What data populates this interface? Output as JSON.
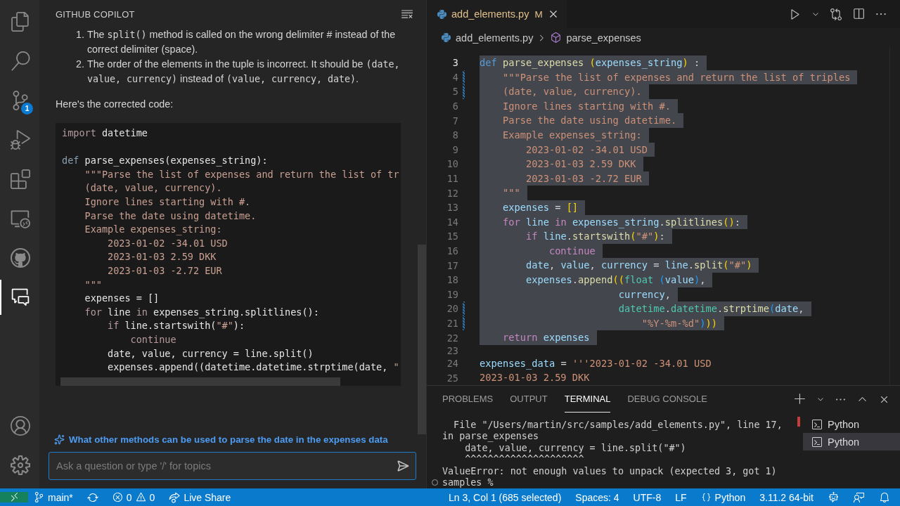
{
  "activity_bar": {
    "items": [
      {
        "kind": "files",
        "selected": false
      },
      {
        "kind": "search",
        "selected": false
      },
      {
        "kind": "source_control",
        "selected": false,
        "badge": "1"
      },
      {
        "kind": "debug",
        "selected": false
      },
      {
        "kind": "extensions",
        "selected": false
      },
      {
        "kind": "remote",
        "selected": false
      },
      {
        "kind": "github",
        "selected": false
      },
      {
        "kind": "chat",
        "selected": true
      }
    ],
    "bottom": [
      {
        "kind": "account"
      },
      {
        "kind": "settings"
      }
    ]
  },
  "sidebar": {
    "title": "GITHUB COPILOT",
    "answer_list": [
      {
        "marker": "1.",
        "segments": [
          {
            "kind": "text",
            "text": "The "
          },
          {
            "kind": "code",
            "text": "split()"
          },
          {
            "kind": "text",
            "text": " method is called on the wrong delimiter # instead of the correct delimiter (space)."
          }
        ]
      },
      {
        "marker": "2.",
        "segments": [
          {
            "kind": "text",
            "text": "The order of the elements in the tuple is incorrect. It should be "
          },
          {
            "kind": "code",
            "text": "(date, value, currency)"
          },
          {
            "kind": "text",
            "text": " instead of "
          },
          {
            "kind": "code",
            "text": "(value, currency, date)"
          },
          {
            "kind": "text",
            "text": "."
          }
        ]
      }
    ],
    "paragraph": "Here's the corrected code:",
    "code_lines": [
      {
        "kind": "code",
        "tokens": [
          {
            "kind": "ctl",
            "text": "import "
          },
          {
            "kind": "pl",
            "text": "datetime"
          }
        ]
      },
      {
        "kind": "blank"
      },
      {
        "kind": "code",
        "tokens": [
          {
            "kind": "kw",
            "text": "def "
          },
          {
            "kind": "fn",
            "text": "parse_expenses"
          },
          {
            "kind": "pl",
            "text": "(expenses_string):"
          }
        ]
      },
      {
        "kind": "code",
        "tokens": [
          {
            "kind": "str",
            "text": "    \"\"\"Parse the list of expenses and return the list of tr"
          }
        ]
      },
      {
        "kind": "code",
        "tokens": [
          {
            "kind": "str",
            "text": "    (date, value, currency)."
          }
        ]
      },
      {
        "kind": "code",
        "tokens": [
          {
            "kind": "str",
            "text": "    Ignore lines starting with #."
          }
        ]
      },
      {
        "kind": "code",
        "tokens": [
          {
            "kind": "str",
            "text": "    Parse the date using datetime."
          }
        ]
      },
      {
        "kind": "code",
        "tokens": [
          {
            "kind": "str",
            "text": "    Example expenses_string:"
          }
        ]
      },
      {
        "kind": "code",
        "tokens": [
          {
            "kind": "str",
            "text": "        2023-01-02 -34.01 USD"
          }
        ]
      },
      {
        "kind": "code",
        "tokens": [
          {
            "kind": "str",
            "text": "        2023-01-03 2.59 DKK"
          }
        ]
      },
      {
        "kind": "code",
        "tokens": [
          {
            "kind": "str",
            "text": "        2023-01-03 -2.72 EUR"
          }
        ]
      },
      {
        "kind": "code",
        "tokens": [
          {
            "kind": "str",
            "text": "    \"\"\""
          }
        ]
      },
      {
        "kind": "code",
        "tokens": [
          {
            "kind": "pl",
            "text": "    expenses = []"
          }
        ]
      },
      {
        "kind": "code",
        "tokens": [
          {
            "kind": "ctl",
            "text": "    for "
          },
          {
            "kind": "pl",
            "text": "line "
          },
          {
            "kind": "ctl",
            "text": "in "
          },
          {
            "kind": "pl",
            "text": "expenses_string.splitlines():"
          }
        ]
      },
      {
        "kind": "code",
        "tokens": [
          {
            "kind": "ctl",
            "text": "        if "
          },
          {
            "kind": "pl",
            "text": "line.startswith("
          },
          {
            "kind": "str",
            "text": "\"#\""
          },
          {
            "kind": "pl",
            "text": "):"
          }
        ]
      },
      {
        "kind": "code",
        "tokens": [
          {
            "kind": "ctl",
            "text": "            continue"
          }
        ]
      },
      {
        "kind": "code",
        "tokens": [
          {
            "kind": "pl",
            "text": "        date, value, currency = line.split()"
          }
        ]
      },
      {
        "kind": "code",
        "tokens": [
          {
            "kind": "pl",
            "text": "        expenses.append((datetime.datetime.strptime(date, "
          },
          {
            "kind": "str",
            "text": "\""
          }
        ]
      }
    ],
    "suggestion": "What other methods can be used to parse the date in the expenses data",
    "input": {
      "placeholder": "Ask a question or type '/' for topics"
    }
  },
  "editor": {
    "tab": {
      "filename": "add_elements.py",
      "status": "M",
      "selected": true
    },
    "breadcrumb": [
      {
        "kind": "file",
        "label": "add_elements.py"
      },
      {
        "kind": "symbol",
        "label": "parse_expenses"
      }
    ],
    "lines": [
      {
        "number": "3",
        "selected": true,
        "active": true,
        "modified": false,
        "tokens": [
          {
            "kind": "kw",
            "text": "def "
          },
          {
            "kind": "fn",
            "text": "parse_expenses "
          },
          {
            "kind": "br",
            "text": "("
          },
          {
            "kind": "var",
            "text": "expenses_string"
          },
          {
            "kind": "br",
            "text": ")"
          },
          {
            "kind": "pl",
            "text": " :"
          }
        ]
      },
      {
        "number": "4",
        "selected": true,
        "active": false,
        "modified": true,
        "tokens": [
          {
            "kind": "str",
            "text": "    \"\"\"Parse the list of expenses and return the list of triples"
          }
        ]
      },
      {
        "number": "5",
        "selected": true,
        "active": false,
        "modified": true,
        "tokens": [
          {
            "kind": "str",
            "text": "    (date, value, currency)."
          }
        ]
      },
      {
        "number": "6",
        "selected": true,
        "active": false,
        "modified": false,
        "tokens": [
          {
            "kind": "str",
            "text": "    Ignore lines starting with #."
          }
        ]
      },
      {
        "number": "7",
        "selected": true,
        "active": false,
        "modified": false,
        "tokens": [
          {
            "kind": "str",
            "text": "    Parse the date using datetime."
          }
        ]
      },
      {
        "number": "8",
        "selected": true,
        "active": false,
        "modified": false,
        "tokens": [
          {
            "kind": "str",
            "text": "    Example expenses_string:"
          }
        ]
      },
      {
        "number": "9",
        "selected": true,
        "active": false,
        "modified": false,
        "tokens": [
          {
            "kind": "str",
            "text": "        2023-01-02 -34.01 USD"
          }
        ]
      },
      {
        "number": "10",
        "selected": true,
        "active": false,
        "modified": false,
        "tokens": [
          {
            "kind": "str",
            "text": "        2023-01-03 2.59 DKK"
          }
        ]
      },
      {
        "number": "11",
        "selected": true,
        "active": false,
        "modified": false,
        "tokens": [
          {
            "kind": "str",
            "text": "        2023-01-03 -2.72 EUR"
          }
        ]
      },
      {
        "number": "12",
        "selected": true,
        "active": false,
        "modified": false,
        "tokens": [
          {
            "kind": "str",
            "text": "    \"\"\""
          }
        ]
      },
      {
        "number": "13",
        "selected": true,
        "active": false,
        "modified": false,
        "tokens": [
          {
            "kind": "var",
            "text": "    expenses"
          },
          {
            "kind": "pl",
            "text": " = "
          },
          {
            "kind": "br",
            "text": "[]"
          }
        ]
      },
      {
        "number": "14",
        "selected": true,
        "active": false,
        "modified": false,
        "tokens": [
          {
            "kind": "ctl",
            "text": "    for "
          },
          {
            "kind": "var",
            "text": "line "
          },
          {
            "kind": "ctl",
            "text": "in "
          },
          {
            "kind": "var",
            "text": "expenses_string"
          },
          {
            "kind": "pl",
            "text": "."
          },
          {
            "kind": "fn",
            "text": "splitlines"
          },
          {
            "kind": "br",
            "text": "()"
          },
          {
            "kind": "pl",
            "text": ":"
          }
        ]
      },
      {
        "number": "15",
        "selected": true,
        "active": false,
        "modified": false,
        "tokens": [
          {
            "kind": "ctl",
            "text": "        if "
          },
          {
            "kind": "var",
            "text": "line"
          },
          {
            "kind": "pl",
            "text": "."
          },
          {
            "kind": "fn",
            "text": "startswith"
          },
          {
            "kind": "br",
            "text": "("
          },
          {
            "kind": "str",
            "text": "\"#\""
          },
          {
            "kind": "br",
            "text": ")"
          },
          {
            "kind": "pl",
            "text": ":"
          }
        ]
      },
      {
        "number": "16",
        "selected": true,
        "active": false,
        "modified": false,
        "tokens": [
          {
            "kind": "ctl",
            "text": "            continue"
          }
        ]
      },
      {
        "number": "17",
        "selected": true,
        "active": false,
        "modified": false,
        "tokens": [
          {
            "kind": "var",
            "text": "        date"
          },
          {
            "kind": "pl",
            "text": ", "
          },
          {
            "kind": "var",
            "text": "value"
          },
          {
            "kind": "pl",
            "text": ", "
          },
          {
            "kind": "var",
            "text": "currency"
          },
          {
            "kind": "pl",
            "text": " = "
          },
          {
            "kind": "var",
            "text": "line"
          },
          {
            "kind": "pl",
            "text": "."
          },
          {
            "kind": "fn",
            "text": "split"
          },
          {
            "kind": "br",
            "text": "("
          },
          {
            "kind": "str",
            "text": "\"#\""
          },
          {
            "kind": "br",
            "text": ")"
          }
        ]
      },
      {
        "number": "18",
        "selected": true,
        "active": false,
        "modified": false,
        "tokens": [
          {
            "kind": "var",
            "text": "        expenses"
          },
          {
            "kind": "pl",
            "text": "."
          },
          {
            "kind": "fn",
            "text": "append"
          },
          {
            "kind": "br",
            "text": "(("
          },
          {
            "kind": "cls",
            "text": "float "
          },
          {
            "kind": "br2",
            "text": "("
          },
          {
            "kind": "var",
            "text": "value"
          },
          {
            "kind": "br2",
            "text": ")"
          },
          {
            "kind": "pl",
            "text": ","
          }
        ]
      },
      {
        "number": "19",
        "selected": true,
        "active": false,
        "modified": false,
        "tokens": [
          {
            "kind": "var",
            "text": "                        currency"
          },
          {
            "kind": "pl",
            "text": ","
          }
        ]
      },
      {
        "number": "20",
        "selected": true,
        "active": false,
        "modified": true,
        "tokens": [
          {
            "kind": "cls",
            "text": "                        datetime"
          },
          {
            "kind": "pl",
            "text": "."
          },
          {
            "kind": "cls",
            "text": "datetime"
          },
          {
            "kind": "pl",
            "text": "."
          },
          {
            "kind": "fn",
            "text": "strptime"
          },
          {
            "kind": "br2",
            "text": "("
          },
          {
            "kind": "var",
            "text": "date"
          },
          {
            "kind": "pl",
            "text": ","
          }
        ]
      },
      {
        "number": "21",
        "selected": true,
        "active": false,
        "modified": true,
        "tokens": [
          {
            "kind": "str",
            "text": "                            \"%Y-%m-%d\""
          },
          {
            "kind": "br2",
            "text": ")"
          },
          {
            "kind": "br",
            "text": "))"
          }
        ]
      },
      {
        "number": "22",
        "selected": true,
        "active": false,
        "modified": false,
        "tokens": [
          {
            "kind": "ctl",
            "text": "    return "
          },
          {
            "kind": "var",
            "text": "expenses"
          }
        ]
      },
      {
        "number": "23",
        "selected": false,
        "active": false,
        "modified": false
      },
      {
        "number": "24",
        "selected": false,
        "active": false,
        "modified": false,
        "tokens": [
          {
            "kind": "var",
            "text": "expenses_data"
          },
          {
            "kind": "pl",
            "text": " = "
          },
          {
            "kind": "str",
            "text": "'''2023-01-02 -34.01 USD"
          }
        ]
      },
      {
        "number": "25",
        "selected": false,
        "active": false,
        "modified": false,
        "tokens": [
          {
            "kind": "str",
            "text": "2023-01-03 2.59 DKK"
          }
        ]
      }
    ]
  },
  "panel": {
    "tabs": [
      {
        "label": "PROBLEMS",
        "selected": false
      },
      {
        "label": "OUTPUT",
        "selected": false
      },
      {
        "label": "TERMINAL",
        "selected": true
      },
      {
        "label": "DEBUG CONSOLE",
        "selected": false
      }
    ],
    "terminal_lines": [
      {
        "kind": "output",
        "text": "  File \"/Users/martin/src/samples/add_elements.py\", line 17,"
      },
      {
        "kind": "output",
        "text": "in parse_expenses"
      },
      {
        "kind": "output",
        "text": "    date, value, currency = line.split(\"#\")"
      },
      {
        "kind": "output",
        "text": "    ^^^^^^^^^^^^^^^^^^^^^"
      },
      {
        "kind": "output",
        "text": "ValueError: not enough values to unpack (expected 3, got 1)"
      },
      {
        "kind": "prompt",
        "text": "samples %"
      }
    ],
    "terminals": [
      {
        "label": "Python",
        "selected": false
      },
      {
        "label": "Python",
        "selected": true
      }
    ]
  },
  "status_bar": {
    "branch": "main*",
    "errors": "0",
    "warnings": "0",
    "live_share": "Live Share",
    "position": "Ln 3, Col 1 (685 selected)",
    "spaces": "Spaces: 4",
    "encoding": "UTF-8",
    "eol": "LF",
    "language": "Python",
    "interpreter": "3.11.2 64-bit"
  }
}
